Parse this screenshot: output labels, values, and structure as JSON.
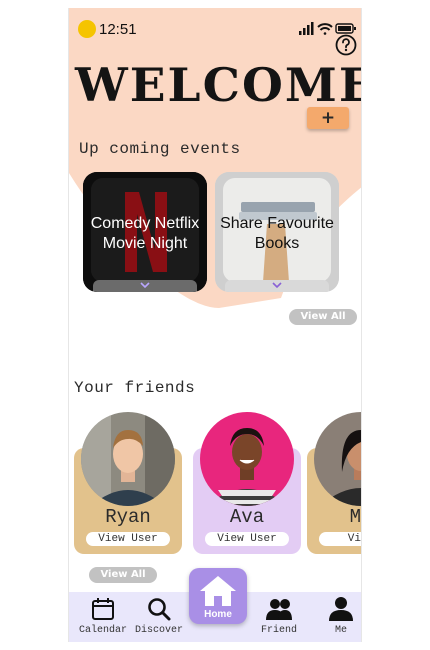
{
  "status": {
    "time": "12:51"
  },
  "header": {
    "title": "WELCOME",
    "add_label": "+"
  },
  "events": {
    "heading": "Up coming events",
    "items": [
      {
        "title_line1": "Comedy Netflix",
        "title_line2": "Movie Night"
      },
      {
        "title_line1": "Share Favourite",
        "title_line2": "Books"
      }
    ],
    "view_all": "View All"
  },
  "friends": {
    "heading": "Your friends",
    "items": [
      {
        "name": "Ryan",
        "view_label": "View User"
      },
      {
        "name": "Ava",
        "view_label": "View User"
      },
      {
        "name": "Ma",
        "view_label": "View"
      }
    ],
    "view_all": "View All"
  },
  "nav": {
    "calendar": "Calendar",
    "discover": "Discover",
    "home": "Home",
    "friend": "Friend",
    "me": "Me"
  },
  "colors": {
    "peach": "#fbd8c4",
    "accent_orange": "#f4a96c",
    "card_tan": "#e2c28c",
    "card_lavender": "#e3ccf4",
    "nav_bg": "#e9e7fb",
    "home_purple": "#a98fe6"
  },
  "icons": [
    "moon-icon",
    "signal-icon",
    "wifi-icon",
    "battery-icon",
    "help-icon",
    "chevron-down-icon",
    "calendar-icon",
    "search-icon",
    "home-icon",
    "friends-icon",
    "person-icon"
  ]
}
